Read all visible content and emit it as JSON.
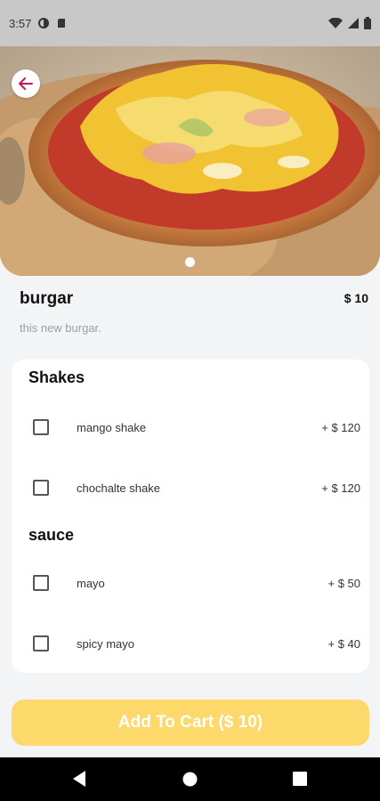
{
  "status_bar": {
    "time": "3:57"
  },
  "product": {
    "title": "burgar",
    "price": "$ 10",
    "description": "this new burgar."
  },
  "option_groups": [
    {
      "title": "Shakes",
      "options": [
        {
          "name": "mango shake",
          "price": "+ $ 120",
          "checked": false
        },
        {
          "name": "chochalte shake",
          "price": "+ $ 120",
          "checked": false
        }
      ]
    },
    {
      "title": "sauce",
      "options": [
        {
          "name": "mayo",
          "price": "+ $ 50",
          "checked": false
        },
        {
          "name": "spicy mayo",
          "price": "+ $ 40",
          "checked": false
        }
      ]
    }
  ],
  "cart_button": {
    "label": "Add To Cart ($ 10)"
  },
  "colors": {
    "accent": "#fcd96a",
    "back_arrow": "#c2185b",
    "background": "#f3f4f6"
  },
  "icons": {
    "back": "arrow-left-icon",
    "nav_back": "triangle-back-icon",
    "nav_home": "circle-home-icon",
    "nav_recents": "square-recents-icon"
  }
}
